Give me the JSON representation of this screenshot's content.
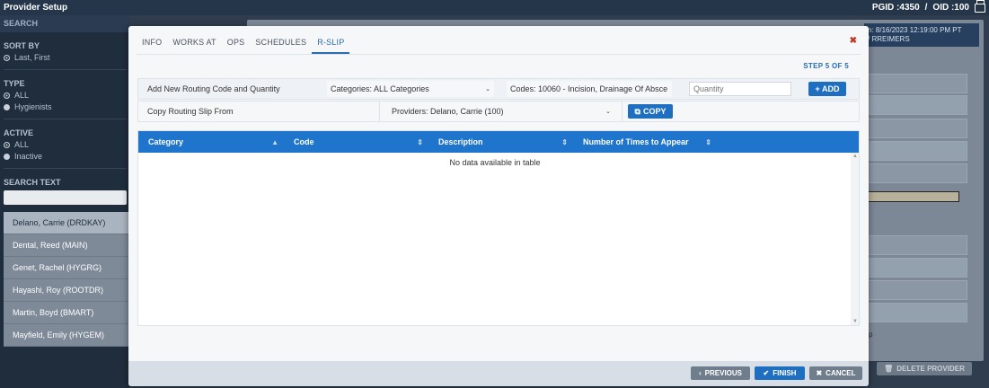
{
  "app": {
    "title": "Provider Setup",
    "pgid": "PGID :4350",
    "separator": "/",
    "oid": "OID :100",
    "print_icon": "printer-icon"
  },
  "sidebar": {
    "header": "SEARCH",
    "sort_by": {
      "label": "SORT BY",
      "options": [
        "Last, First"
      ],
      "selected": "Last, First"
    },
    "type": {
      "label": "TYPE",
      "options": [
        "ALL",
        "Hygienists"
      ],
      "selected": "ALL"
    },
    "active": {
      "label": "ACTIVE",
      "options": [
        "ALL",
        "Inactive"
      ],
      "selected": "ALL"
    },
    "search_text": {
      "label": "SEARCH TEXT",
      "value": ""
    },
    "providers": [
      "Delano, Carrie (DRDKAY)",
      "Dental, Reed (MAIN)",
      "Genet, Rachel (HYGRG)",
      "Hayashi, Roy (ROOTDR)",
      "Martin, Boyd (BMART)",
      "Mayfield, Emily (HYGEM)"
    ],
    "selected_provider": "Delano, Carrie (DRDKAY)"
  },
  "background": {
    "info_line1": "n: 8/16/2023 12:19:00 PM PT",
    "info_line2": "/ RREIMERS",
    "partial_text": "p",
    "delete_label": "DELETE PROVIDER",
    "delete_icon": "trash-icon"
  },
  "modal": {
    "tabs": [
      "INFO",
      "WORKS AT",
      "OPS",
      "SCHEDULES",
      "R-SLIP"
    ],
    "active_tab": "R-SLIP",
    "close_icon": "close-icon",
    "step": "STEP 5 OF 5",
    "add_row": {
      "label": "Add New Routing Code and Quantity",
      "categories": "Categories: ALL Categories",
      "codes": "Codes: 10060 - Incision, Drainage Of Absce",
      "quantity_placeholder": "Quantity",
      "add_label": "+ ADD"
    },
    "copy_row": {
      "label": "Copy Routing Slip From",
      "providers": "Providers: Delano, Carrie (100)",
      "copy_label": "COPY",
      "copy_icon": "copy-icon"
    },
    "table": {
      "columns": [
        "Category",
        "Code",
        "Description",
        "Number of Times to Appear"
      ],
      "empty_message": "No data available in table"
    },
    "footer": {
      "previous": "PREVIOUS",
      "finish": "FINISH",
      "cancel": "CANCEL"
    }
  },
  "colors": {
    "primary": "#1f75cc",
    "header_bg": "#25364b",
    "close": "#c0392b",
    "footer_btn_gray": "#6f7d8c"
  }
}
